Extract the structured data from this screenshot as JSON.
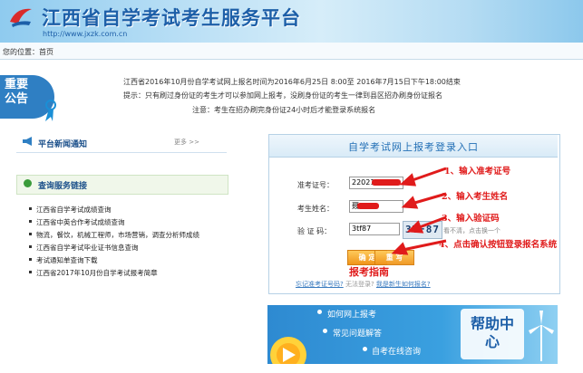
{
  "header": {
    "title": "江西省自学考试考生服务平台",
    "url": "http://www.jxzk.com.cn"
  },
  "breadcrumb": {
    "label": "您的位置：",
    "home": "首页"
  },
  "notice": {
    "badge": "重要公告",
    "lines": [
      "江西省2016年10月份自学考试网上报名时间为2016年6月25日  8:00至  2016年7月15日下午18:00结束",
      "提示：只有刷过身份证的考生才可以参加网上报考，没刷身份证的考生一律到县区招办刷身份证报名",
      "注意：考生在招办刷完身份证24小时后才能登录系统报名"
    ]
  },
  "news": {
    "title": "平台新闻通知",
    "more": "更多 >>"
  },
  "query": {
    "title": "查询服务链接",
    "items": [
      "江西省自学考试成绩查询",
      "江西省中英合作考试成绩查询",
      "物流，餐饮，机械工程师，市场营销，调查分析师成绩",
      "江西省自学考试毕业证书信息查询",
      "考试通知单查询下载",
      "江西省2017年10月份自学考试报考简章"
    ]
  },
  "login": {
    "title": "自学考试网上报考登录入口",
    "exam_id_label": "准考证号：",
    "exam_id_value": "22021",
    "name_label": "考生姓名：",
    "name_value": "聂",
    "captcha_label": "验 证 码：",
    "captcha_value": "3tf87",
    "captcha_image": "3TF87",
    "captcha_hint": "看不清，点击换一个",
    "confirm_label": "确  定",
    "reset_label": "重  写",
    "forgot_link": "忘记准考证号码?",
    "cannot_login": "无法登录?",
    "new_reg_link": "我是新生如何报名?"
  },
  "annotations": {
    "guide_title": "报考指南",
    "step1": "1、输入准考证号",
    "step2": "2、输入考生姓名",
    "step3": "3、输入验证码",
    "step4": "4、点击确认按钮登录报名系统"
  },
  "help": {
    "items": [
      "如何网上报考",
      "常见问题解答",
      "自考在线咨询"
    ],
    "title": "帮助中心"
  },
  "colors": {
    "brand_blue": "#1d5fa8",
    "annotation_red": "#e01b1b",
    "button_orange": "#f0951c"
  }
}
